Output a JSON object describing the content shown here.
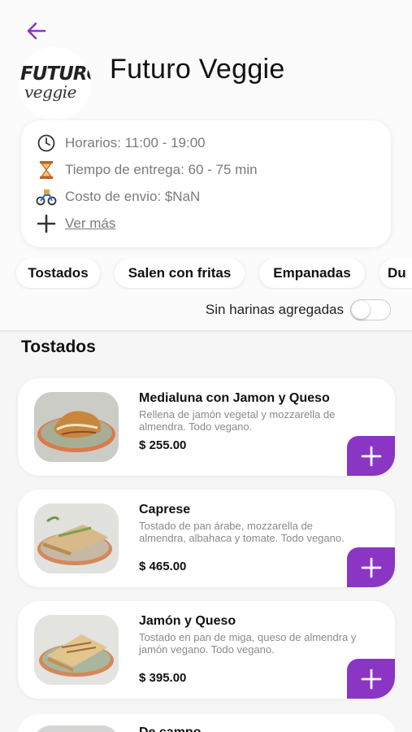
{
  "colors": {
    "accent": "#8a35c4",
    "text": "#111111",
    "muted": "#7b7b7b"
  },
  "header": {
    "back_icon": "back-arrow-icon",
    "restaurant_name": "Futuro Veggie",
    "logo_line1": "FUTURO",
    "logo_line2": "veggie"
  },
  "info": {
    "hours": "Horarios: 11:00 - 19:00",
    "delivery_time": "Tiempo de entrega: 60 - 75 min",
    "shipping_cost": "Costo de envio: $NaN",
    "more": "Ver más"
  },
  "categories": [
    "Tostados",
    "Salen con fritas",
    "Empanadas",
    "Du"
  ],
  "filter": {
    "label": "Sin harinas agregadas",
    "enabled": false
  },
  "section_title": "Tostados",
  "products": [
    {
      "name": "Medialuna con Jamon y Queso",
      "description": "Rellena de jamón vegetal y mozzarella de almendra. Todo vegano.",
      "price": "$ 255.00"
    },
    {
      "name": "Caprese",
      "description": "Tostado de pan árabe, mozzarella de almendra, albahaca y tomate. Todo vegano.",
      "price": "$ 465.00"
    },
    {
      "name": "Jamón y Queso",
      "description": "Tostado en pan de miga, queso de almendra y jamón vegano. Todo vegano.",
      "price": "$ 395.00"
    },
    {
      "name": "De campo"
    }
  ]
}
